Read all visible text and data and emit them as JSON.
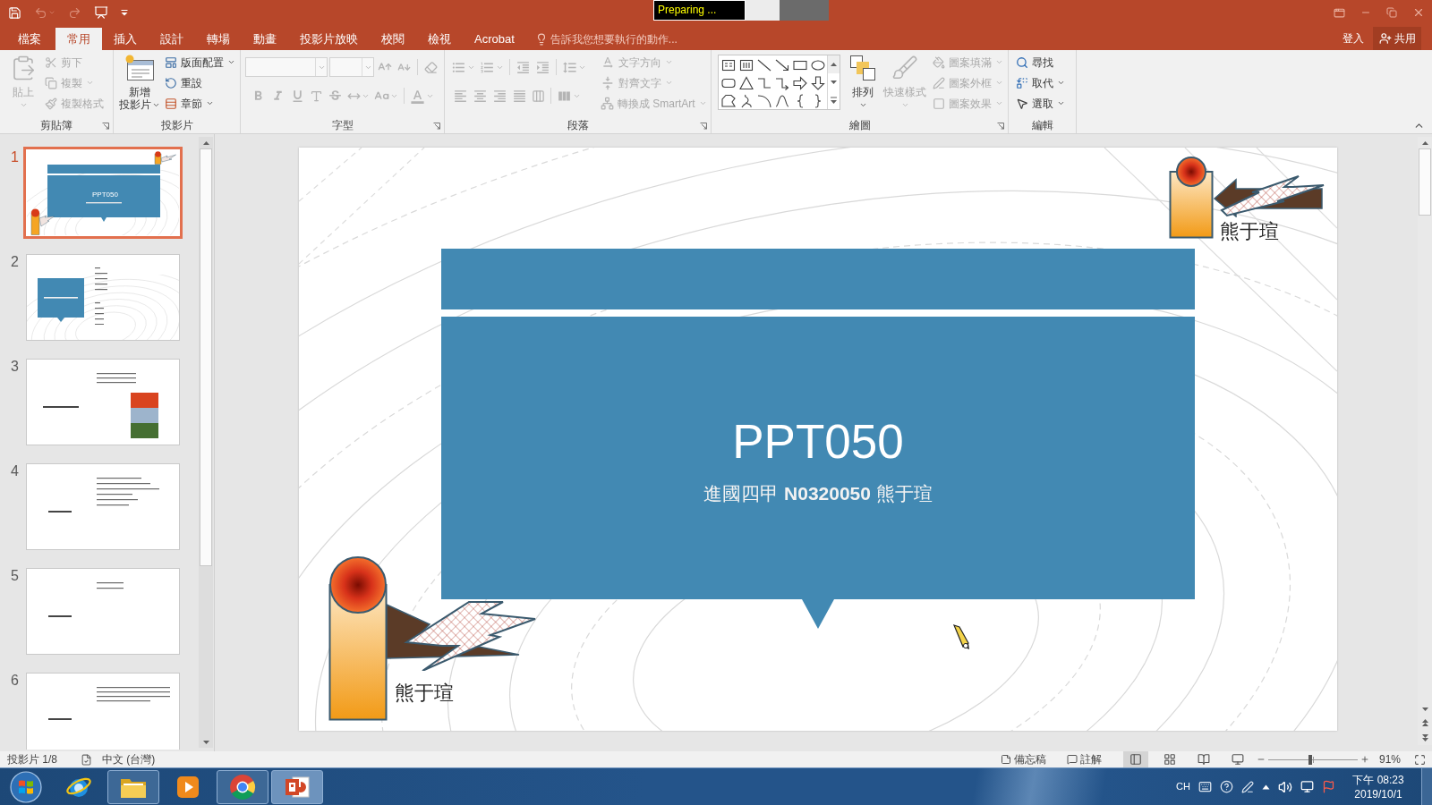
{
  "title_bar": {
    "quick_access": [
      {
        "disabled": false
      },
      {
        "disabled": true
      },
      {
        "disabled": true
      },
      {
        "disabled": false
      }
    ],
    "recorder_status": "Preparing ..."
  },
  "tabs": [
    {
      "label": "檔案",
      "selected": false
    },
    {
      "label": "常用",
      "selected": true
    },
    {
      "label": "插入",
      "selected": false
    },
    {
      "label": "設計",
      "selected": false
    },
    {
      "label": "轉場",
      "selected": false
    },
    {
      "label": "動畫",
      "selected": false
    },
    {
      "label": "投影片放映",
      "selected": false
    },
    {
      "label": "校閱",
      "selected": false
    },
    {
      "label": "檢視",
      "selected": false
    },
    {
      "label": "Acrobat",
      "selected": false
    }
  ],
  "tell_me": {
    "placeholder": "告訴我您想要執行的動作..."
  },
  "account": {
    "sign_in": "登入",
    "share": "共用"
  },
  "ribbon_groups": [
    {
      "kind": "clipboard",
      "label": "剪貼簿",
      "launcher": true,
      "items": [
        {
          "label": "貼上",
          "disabled": true
        },
        {
          "label": "剪下",
          "disabled": true
        },
        {
          "label": "複製",
          "disabled": true
        },
        {
          "label": "複製格式",
          "disabled": true
        }
      ]
    },
    {
      "kind": "slides",
      "label": "投影片",
      "items": [
        {
          "label": "新增",
          "label_2": "投影片",
          "disabled": false
        },
        {
          "label": "版面配置",
          "disabled": false
        },
        {
          "label": "重設",
          "disabled": false
        },
        {
          "label": "章節",
          "disabled": false
        }
      ]
    },
    {
      "kind": "font",
      "label": "字型",
      "launcher": true,
      "disabled": true
    },
    {
      "kind": "paragraph",
      "label": "段落",
      "launcher": true,
      "disabled": true,
      "items": [
        {
          "label": "文字方向",
          "disabled": true
        },
        {
          "label": "對齊文字",
          "disabled": true
        },
        {
          "label": "轉換成 SmartArt",
          "disabled": true
        }
      ]
    },
    {
      "kind": "drawing",
      "label": "繪圖",
      "launcher": true,
      "items": [
        {
          "label": "排列",
          "disabled": false
        },
        {
          "label": "快速樣式",
          "disabled": true
        },
        {
          "label": "圖案填滿",
          "disabled": true
        },
        {
          "label": "圖案外框",
          "disabled": true
        },
        {
          "label": "圖案效果",
          "disabled": true
        }
      ]
    },
    {
      "kind": "editing",
      "label": "編輯",
      "items": [
        {
          "label": "尋找",
          "disabled": false
        },
        {
          "label": "取代",
          "disabled": false
        },
        {
          "label": "選取",
          "disabled": false
        }
      ]
    }
  ],
  "thumbnails": [
    {
      "number": "1",
      "kind": "title",
      "title": "PPT050",
      "selected": true
    },
    {
      "number": "2",
      "kind": "section",
      "selected": false
    },
    {
      "number": "3",
      "kind": "photos",
      "selected": false
    },
    {
      "number": "4",
      "kind": "bullets",
      "selected": false
    },
    {
      "number": "5",
      "kind": "short-bullets",
      "selected": false
    },
    {
      "number": "6",
      "kind": "paragraph",
      "selected": false
    }
  ],
  "slide": {
    "title": "PPT050",
    "subtitle": "進國四甲 **N0320050** 熊于瑄",
    "callouts": [
      {
        "label": "熊于瑄"
      },
      {
        "label": "熊于瑄"
      }
    ]
  },
  "status_bar": {
    "slide_info": "投影片 1/8",
    "language": "中文 (台灣)",
    "notes": "備忘稿",
    "comments": "註解",
    "views": [
      {
        "selected": true
      },
      {
        "selected": false
      },
      {
        "selected": false
      },
      {
        "selected": false
      }
    ],
    "zoom": {
      "level": 0.47,
      "reading": "91%"
    }
  },
  "taskbar": {
    "apps": [
      {
        "running": false,
        "selected": false
      },
      {
        "running": true,
        "selected": false
      },
      {
        "running": false,
        "selected": false
      },
      {
        "running": true,
        "selected": false
      },
      {
        "running": true,
        "selected": true
      }
    ],
    "input_language": "CH",
    "time": "下午 08:23",
    "date": "2019/10/1"
  }
}
